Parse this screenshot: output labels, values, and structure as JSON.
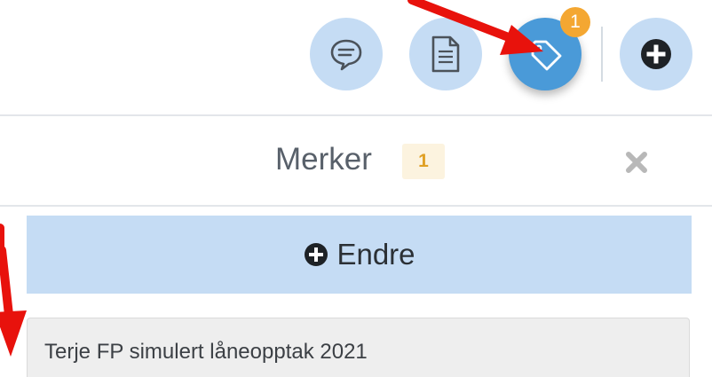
{
  "toolbar": {
    "buttons": [
      {
        "id": "comment",
        "icon": "comment-icon"
      },
      {
        "id": "document",
        "icon": "document-icon"
      },
      {
        "id": "tags",
        "icon": "tag-icon",
        "active": true,
        "badge": "1"
      },
      {
        "id": "add",
        "icon": "plus-circle-icon"
      }
    ],
    "tag_badge": "1"
  },
  "panel": {
    "title": "Merker",
    "count": "1",
    "close_icon": "close-icon"
  },
  "edit_button": {
    "label": "Endre",
    "icon": "plus-circle-icon"
  },
  "tags": [
    {
      "label": "Terje FP simulert låneopptak 2021"
    }
  ],
  "colors": {
    "button_bg": "#c5dcf4",
    "active_button_bg": "#4a9ad8",
    "badge": "#f4a732",
    "count_bg": "#fcf3df",
    "count_text": "#e0a024",
    "annotation_arrow": "#e8120c"
  }
}
